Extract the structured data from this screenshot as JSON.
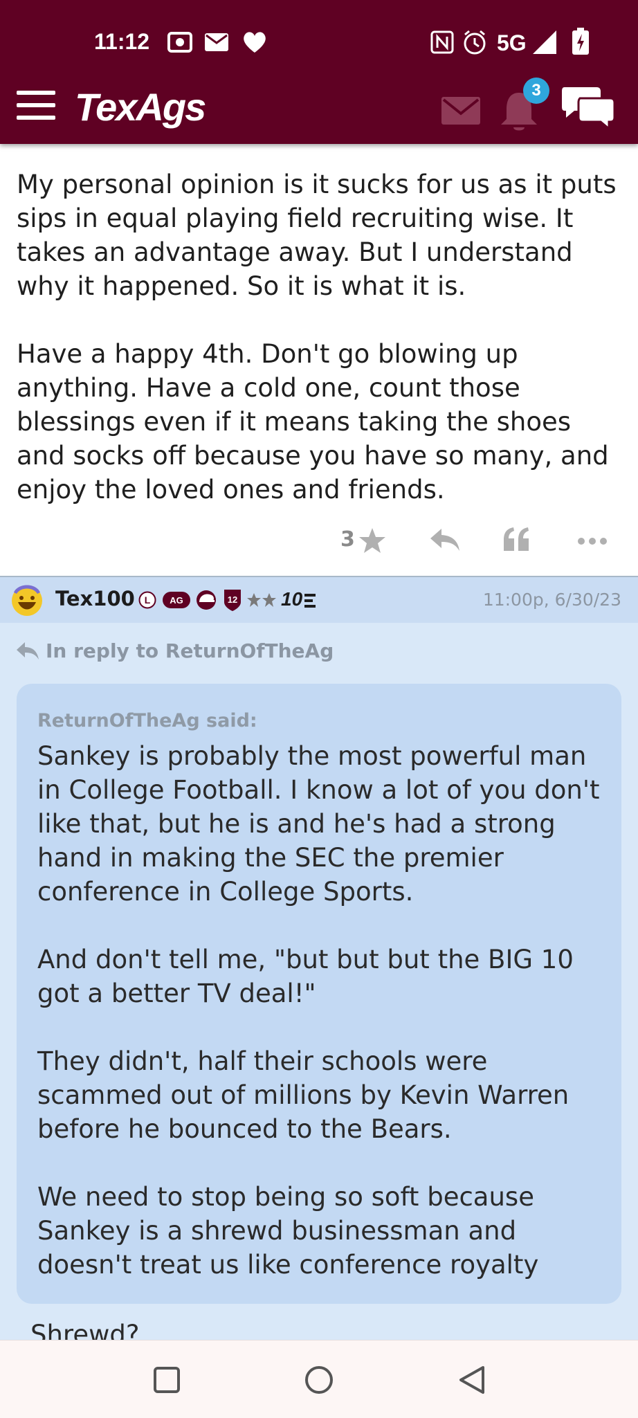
{
  "status_bar": {
    "time": "11:12",
    "left_icons": [
      "screen-record-icon",
      "mail-notification-icon",
      "heart-notification-icon"
    ],
    "right_icons": [
      "nfc-icon",
      "alarm-icon",
      "5g-icon",
      "signal-icon",
      "battery-charging-icon"
    ],
    "network": "5G"
  },
  "app_bar": {
    "logo": "TexAgs",
    "notification_count": "3",
    "icons": [
      "menu-icon",
      "mail-icon",
      "bell-icon",
      "chat-icon"
    ]
  },
  "post1": {
    "paragraphs": [
      "My personal opinion is it sucks for us as it puts sips in equal playing field recruiting wise. It takes an advantage away. But I understand why it happened. So it is what it is.",
      "Have a happy 4th. Don't go blowing up anything. Have a cold one, count those blessings even if it means taking the shoes and socks off because you have so many, and enjoy the loved ones and friends."
    ],
    "star_count": "3"
  },
  "post2": {
    "username": "Tex100",
    "rank_badge": "10",
    "time": "11:00p, 6/30/23",
    "in_reply_to": "In reply to ReturnOfTheAg",
    "quote": {
      "author": "ReturnOfTheAg said:",
      "paragraphs": [
        "Sankey is probably the most powerful man in College Football. I know a lot of you don't like that, but he is and he's had a strong hand in making the SEC the premier conference in College Sports.",
        "And don't tell me, \"but but but the BIG 10 got a better TV deal!\"",
        "They didn't, half their schools were scammed out of millions by Kevin Warren before he bounced to the Bears.",
        "We need to stop being so soft because Sankey is a shrewd businessman and doesn't treat us like conference royalty"
      ]
    },
    "reply_text": "Shrewd?"
  },
  "colors": {
    "brand_maroon": "#5f0123",
    "reply_background": "#d9e8f8",
    "quote_background": "#c3d9f3",
    "badge_blue": "#2fa6dc"
  }
}
